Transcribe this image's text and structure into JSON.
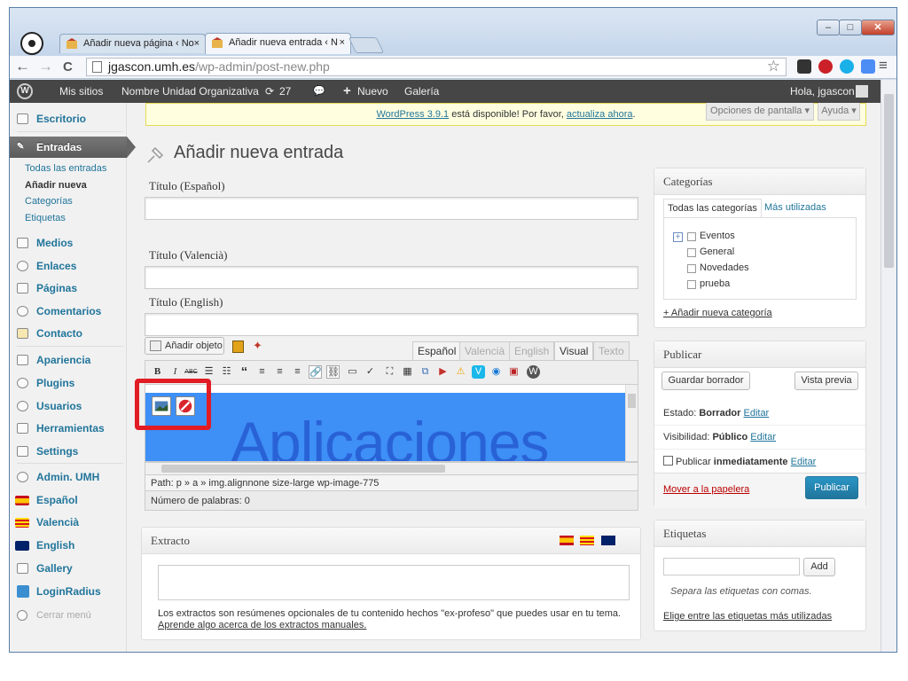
{
  "browser": {
    "tabs": [
      {
        "title": "Añadir nueva página ‹ No",
        "close": "×"
      },
      {
        "title": "Añadir nueva entrada ‹ N",
        "close": "×"
      }
    ],
    "window_buttons": {
      "minimize": "–",
      "maximize": "□",
      "close": "✕"
    },
    "nav": {
      "back": "←",
      "forward": "→",
      "reload": "C"
    },
    "url_host": "jgascon.umh.es",
    "url_path": "/wp-admin/post-new.php",
    "menu": "≡",
    "star": "☆"
  },
  "adminbar": {
    "wp_logo": "W",
    "my_sites": "Mis sitios",
    "site_name": "Nombre Unidad Organizativa",
    "updates_icon": "⟳",
    "updates": "27",
    "comments_icon": "💬",
    "new": "Nuevo",
    "new_icon": "+",
    "gallery": "Galería",
    "greeting": "Hola, jgascon"
  },
  "sidebar": {
    "items": [
      {
        "label": "Escritorio"
      },
      {
        "label": "Entradas"
      },
      {
        "label": "Medios"
      },
      {
        "label": "Enlaces"
      },
      {
        "label": "Páginas"
      },
      {
        "label": "Comentarios"
      },
      {
        "label": "Contacto"
      },
      {
        "label": "Apariencia"
      },
      {
        "label": "Plugins"
      },
      {
        "label": "Usuarios"
      },
      {
        "label": "Herramientas"
      },
      {
        "label": "Settings"
      },
      {
        "label": "Admin. UMH"
      },
      {
        "label": "Español"
      },
      {
        "label": "Valencià"
      },
      {
        "label": "English"
      },
      {
        "label": "Gallery"
      },
      {
        "label": "LoginRadius"
      },
      {
        "label": "Cerrar menú"
      }
    ],
    "subitems": [
      "Todas las entradas",
      "Añadir nueva",
      "Categorías",
      "Etiquetas"
    ]
  },
  "notice": {
    "link": "WordPress 3.9.1",
    "text": " está disponible! Por favor, ",
    "action": "actualiza ahora",
    "end": "."
  },
  "screen_options": "Opciones de pantalla ▾",
  "help": "Ayuda ▾",
  "page_title": "Añadir nueva entrada",
  "fields": {
    "title_es": "Título (Español)",
    "title_va": "Título (Valencià)",
    "title_en": "Título (English)"
  },
  "editor": {
    "add_media": "Añadir objeto",
    "lang_tabs": [
      "Español",
      "Valencià",
      "English"
    ],
    "mode_visual": "Visual",
    "mode_text": "Texto",
    "toolbar": [
      "B",
      "I",
      "ABC",
      "☰",
      "☷",
      "“",
      "≡",
      "≡",
      "≡",
      "🔗",
      "⛓",
      "▭",
      "✓",
      "⛶",
      "▦",
      "⧉",
      "▶",
      "⚠",
      "V",
      "◉",
      "▣",
      "W"
    ],
    "content_text": "Aplicaciones",
    "path": "Path: p » a » img.alignnone size-large wp-image-775",
    "word_count": "Número de palabras: 0"
  },
  "excerpt": {
    "title": "Extracto",
    "help": "Los extractos son resúmenes opcionales de tu contenido hechos \"ex-profeso\" que puedes usar en tu tema.",
    "link": "Aprende algo acerca de los extractos manuales."
  },
  "categories": {
    "title": "Categorías",
    "tab_all": "Todas las categorías",
    "tab_popular": "Más utilizadas",
    "items": [
      "Eventos",
      "General",
      "Novedades",
      "prueba"
    ],
    "add_new": "+ Añadir nueva categoría"
  },
  "publish": {
    "title": "Publicar",
    "save_draft": "Guardar borrador",
    "preview": "Vista previa",
    "status_label": "Estado: ",
    "status_value": "Borrador",
    "visibility_label": "Visibilidad: ",
    "visibility_value": "Público",
    "schedule_label": "Publicar ",
    "schedule_value": "inmediatamente",
    "edit": "Editar",
    "trash": "Mover a la papelera",
    "publish": "Publicar"
  },
  "tags": {
    "title": "Etiquetas",
    "add": "Add",
    "hint": "Separa las etiquetas con comas.",
    "choose": "Elige entre las etiquetas más utilizadas"
  }
}
